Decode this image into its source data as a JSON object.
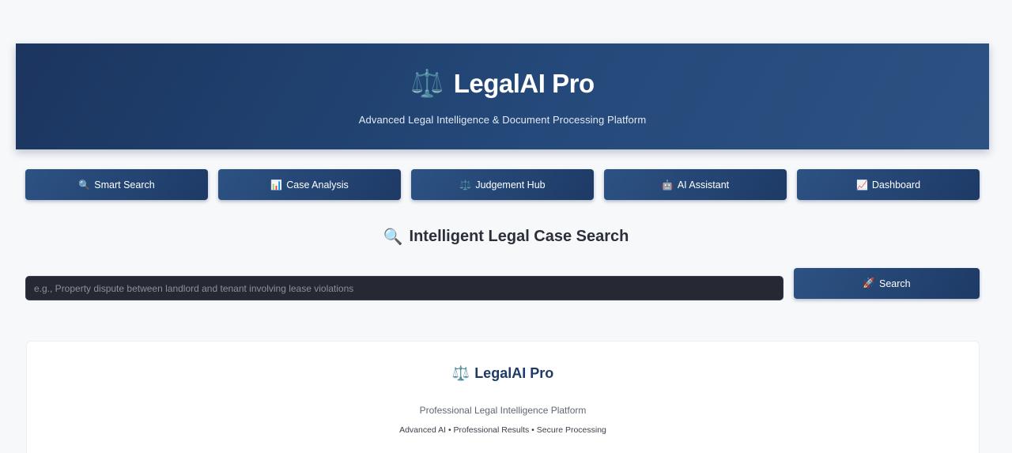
{
  "header": {
    "logo_icon": "⚖️",
    "title": "LegalAI Pro",
    "subtitle": "Advanced Legal Intelligence & Document Processing Platform"
  },
  "nav": {
    "tabs": [
      {
        "icon": "🔍",
        "label": "Smart Search"
      },
      {
        "icon": "📊",
        "label": "Case Analysis"
      },
      {
        "icon": "⚖️",
        "label": "Judgement Hub"
      },
      {
        "icon": "🤖",
        "label": "AI Assistant"
      },
      {
        "icon": "📈",
        "label": "Dashboard"
      }
    ]
  },
  "search": {
    "heading_icon": "🔍",
    "heading": "Intelligent Legal Case Search",
    "placeholder": "e.g., Property dispute between landlord and tenant involving lease violations",
    "value": "",
    "button_icon": "🚀",
    "button_label": "Search"
  },
  "footer": {
    "icon": "⚖️",
    "brand": "LegalAI Pro",
    "tagline": "Professional Legal Intelligence Platform",
    "features": "Advanced AI • Professional Results • Secure Processing"
  },
  "colors": {
    "primary": "#1e3a66",
    "primary_light": "#2c5283",
    "background": "#f6f8fa",
    "input_bg": "#262833"
  }
}
